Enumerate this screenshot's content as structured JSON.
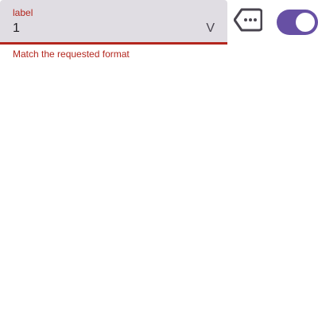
{
  "text_field": {
    "label": "label",
    "value": "1",
    "suffix": "V",
    "supporting_text": "Match the requested format",
    "error_color": "#b3261e"
  },
  "tag_button": {
    "icon": "label-more-icon"
  },
  "toggle": {
    "checked": true,
    "accent_color": "#6750a4"
  }
}
